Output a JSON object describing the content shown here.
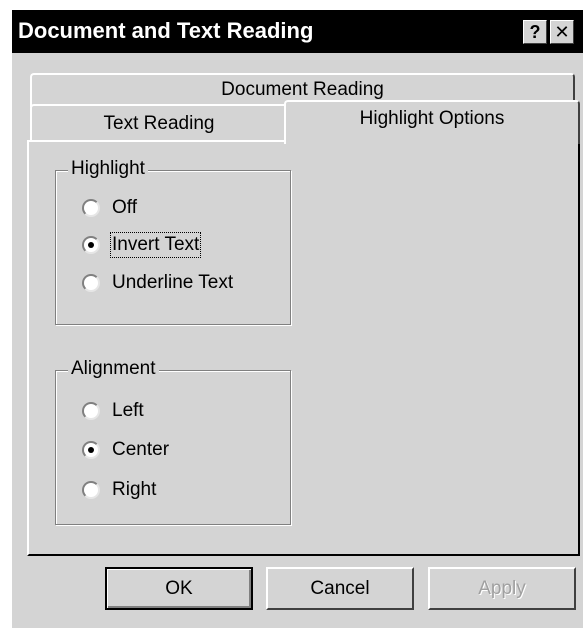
{
  "window": {
    "title": "Document and Text Reading",
    "help_glyph": "?",
    "close_glyph": "✕"
  },
  "tabs": {
    "row_back": [
      "Document Reading"
    ],
    "row_front": [
      "Text Reading",
      "Highlight Options"
    ],
    "active": "Highlight Options"
  },
  "highlight": {
    "label": "Highlight",
    "options": [
      {
        "label": "Off",
        "checked": false
      },
      {
        "label": "Invert Text",
        "checked": true
      },
      {
        "label": "Underline Text",
        "checked": false
      }
    ]
  },
  "alignment": {
    "label": "Alignment",
    "options": [
      {
        "label": "Left",
        "checked": false
      },
      {
        "label": "Center",
        "checked": true
      },
      {
        "label": "Right",
        "checked": false
      }
    ]
  },
  "buttons": {
    "ok": "OK",
    "cancel": "Cancel",
    "apply": "Apply"
  },
  "colors": {
    "titlebar": "#000000",
    "face": "#d4d4d4"
  }
}
